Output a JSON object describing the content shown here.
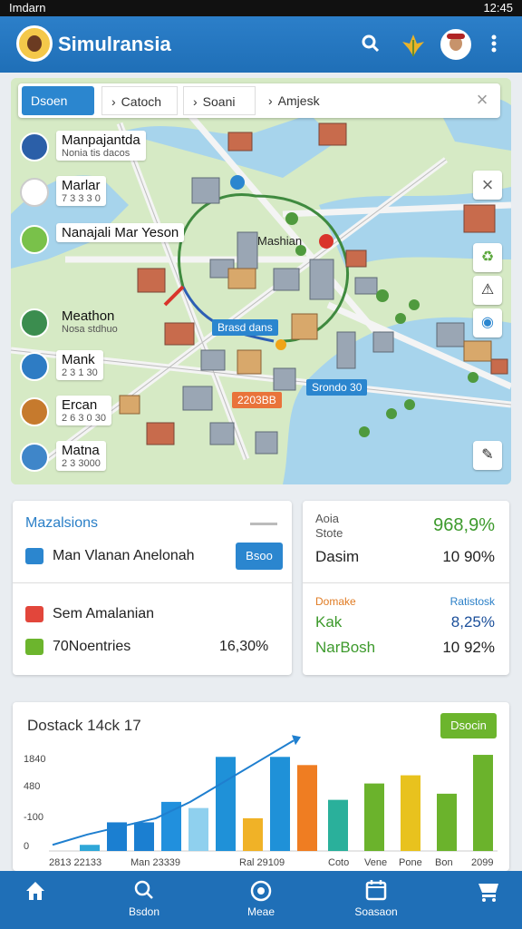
{
  "status": {
    "carrier": "Imdarn",
    "time": "12:45"
  },
  "app": {
    "title": "Simulransia"
  },
  "icons": {
    "search": "search-icon",
    "plant": "leaf-icon",
    "more": "more-vert-icon"
  },
  "tabs": [
    {
      "label": "Dsoen"
    },
    {
      "label": "Catoch"
    },
    {
      "label": "Soani"
    },
    {
      "label": "Amjesk"
    }
  ],
  "poi": [
    {
      "name": "Manpajantda",
      "sub": "Nonia tis dacos",
      "color": "#2b5fa8"
    },
    {
      "name": "Marlar",
      "sub": "7 3 3 3 0",
      "color": "#ffffff"
    },
    {
      "name": "Nanajali  Mar Yeson",
      "sub": "",
      "color": "#79c14a"
    },
    {
      "name": "Meathon",
      "sub": "Nosa stdhuo",
      "color": "#3b8d4f"
    },
    {
      "name": "Mank",
      "sub": "2 3 1 30",
      "color": "#2e7cc4"
    },
    {
      "name": "Ercan",
      "sub": "2 6 3 0 30",
      "color": "#c67a2d"
    },
    {
      "name": "Matna",
      "sub": "2 3 3000",
      "color": "#3f86c9"
    }
  ],
  "map_labels": {
    "district": "Mashian",
    "price": "2203BB",
    "tag1": "Brasd dans",
    "tag2": "Srondo 30"
  },
  "card1": {
    "header": "Mazalsions",
    "row1": "Man Vlanan Anelonah",
    "button": "Bsoo",
    "row2": "Sem Amalanian",
    "row3": "70Noentries",
    "row3_value": "16,30%"
  },
  "card2": {
    "label1": "Aoia",
    "label2": "Stote",
    "value1": "968,9%",
    "name2": "Dasim",
    "value2": "10 90%",
    "head3a": "Domake",
    "head3b": "Ratistosk",
    "name3": "Kak",
    "value3": "8,25%",
    "name4": "NarBosh",
    "value4": "10 92%"
  },
  "chart_card": {
    "title": "Dostack 14ck 17",
    "button": "Dsocin"
  },
  "chart_data": {
    "type": "bar",
    "title": "Dostack 14ck 17",
    "ytick_labels": [
      "1840",
      "480",
      "-100",
      "0"
    ],
    "xtick_labels": [
      "2813 22133",
      "Man 23339",
      "Ral 29109",
      "Coto",
      "Vene",
      "Pone",
      "Bon",
      "2099"
    ],
    "values": [
      3,
      14,
      14,
      24,
      21,
      46,
      16,
      46,
      42,
      25,
      33,
      37,
      28,
      47
    ],
    "colors": [
      "#2fa7d8",
      "#1b7fd1",
      "#1b7fd1",
      "#2190dd",
      "#8fd0ee",
      "#1f91d8",
      "#f0b227",
      "#1f91d8",
      "#ef7d22",
      "#2ab09b",
      "#6bb32c",
      "#e8c21e",
      "#6bb32c",
      "#6bb32c"
    ],
    "trend": [
      3,
      8,
      12,
      16,
      24,
      34,
      44,
      54
    ],
    "ylim": [
      0,
      55
    ]
  },
  "bottom_nav": [
    {
      "label": "",
      "icon": "home-icon"
    },
    {
      "label": "Bsdon",
      "icon": "search-icon"
    },
    {
      "label": "Meae",
      "icon": "location-icon"
    },
    {
      "label": "Soasaon",
      "icon": "calendar-icon"
    },
    {
      "label": "",
      "icon": "cart-icon"
    }
  ]
}
